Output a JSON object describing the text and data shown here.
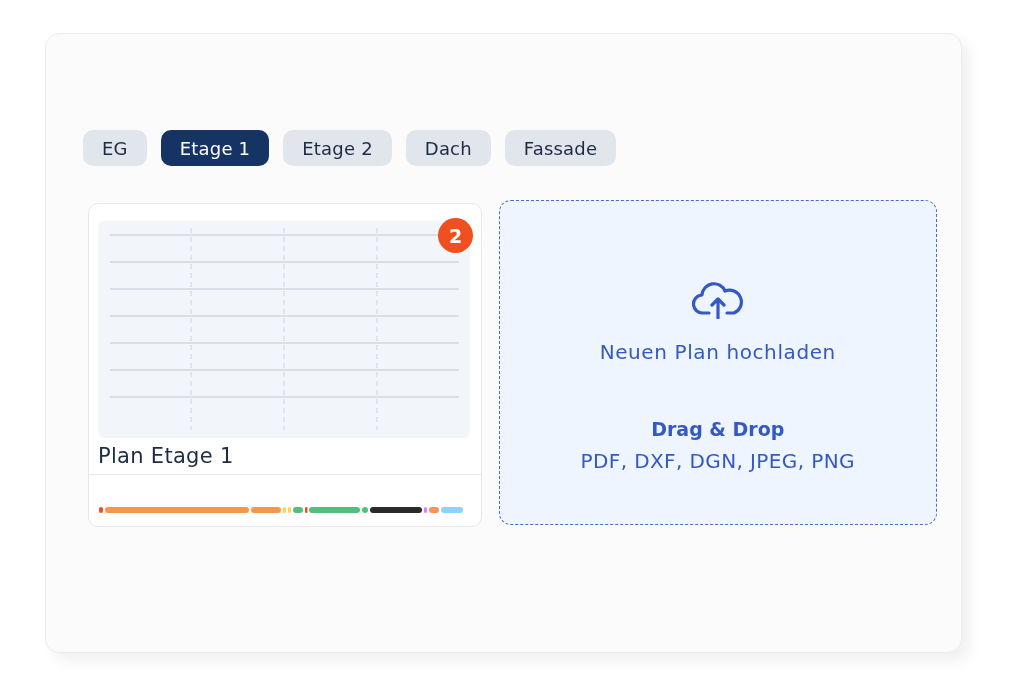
{
  "tabs": [
    {
      "label": "EG",
      "selected": false
    },
    {
      "label": "Etage 1",
      "selected": true
    },
    {
      "label": "Etage 2",
      "selected": false
    },
    {
      "label": "Dach",
      "selected": false
    },
    {
      "label": "Fassade",
      "selected": false
    }
  ],
  "plan_card": {
    "title": "Plan Etage 1",
    "badge": "2"
  },
  "upload": {
    "label": "Neuen Plan hochladen",
    "hint_title": "Drag & Drop",
    "formats": "PDF, DXF, DGN, JPEG, PNG"
  }
}
